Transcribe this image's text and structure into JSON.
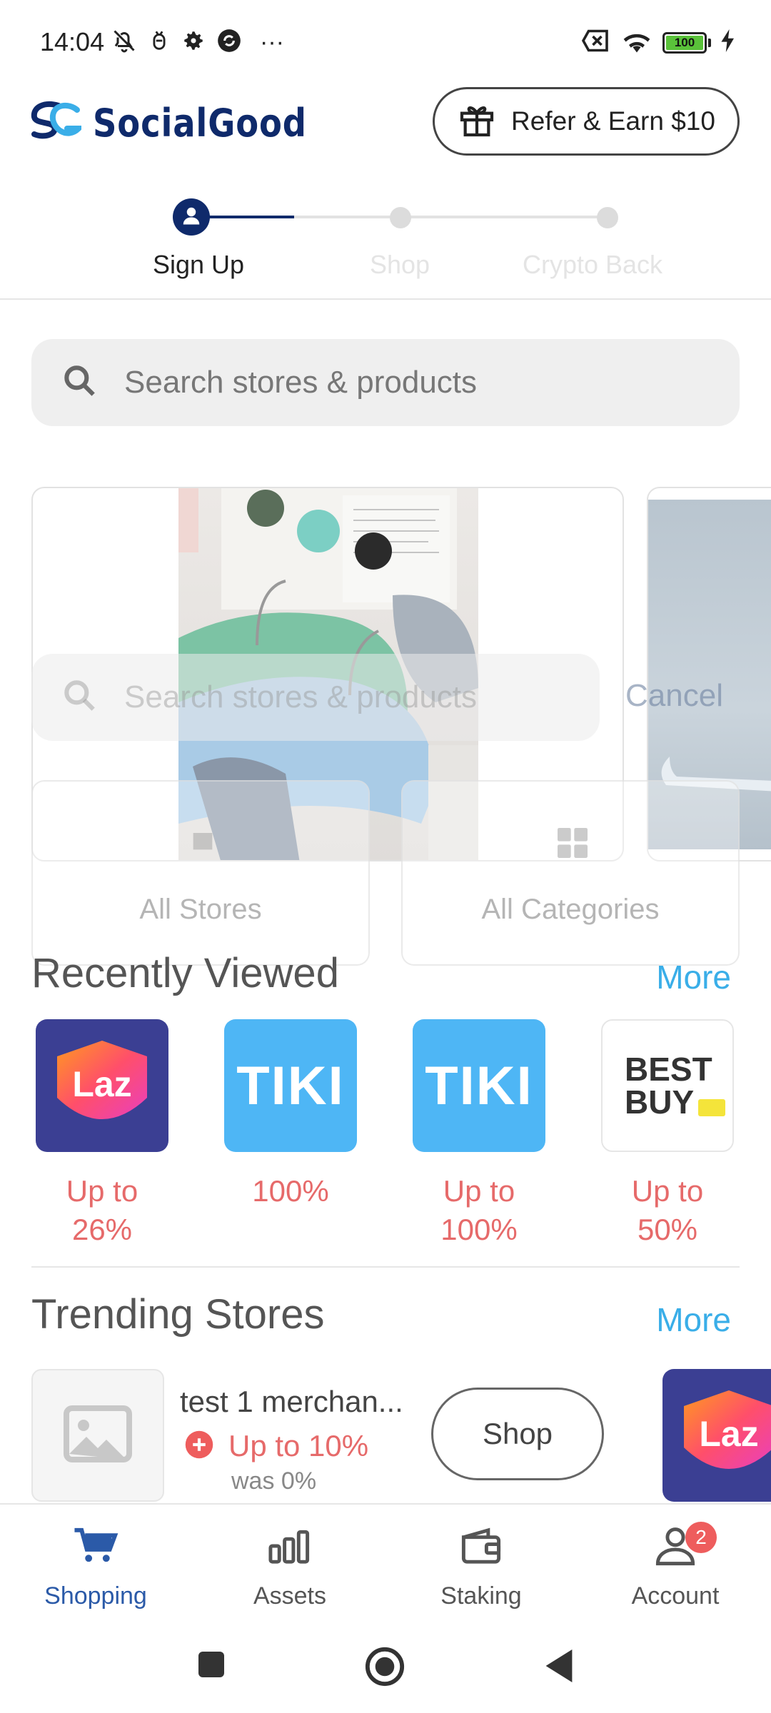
{
  "status_bar": {
    "time": "14:04",
    "left_icons": [
      "bell-off-icon",
      "bug-icon",
      "gear-icon",
      "sync-icon",
      "more-dots-icon"
    ],
    "more_glyph": "···",
    "battery_level": "100"
  },
  "header": {
    "brand": "SocialGood",
    "refer_label": "Refer & Earn $10"
  },
  "stepper": {
    "steps": [
      {
        "label": "Sign Up"
      },
      {
        "label": "Shop"
      },
      {
        "label": "Crypto Back"
      }
    ]
  },
  "search": {
    "placeholder": "Search stores & products"
  },
  "overlay": {
    "search_placeholder": "Search stores & products",
    "cancel_label": "Cancel",
    "cards": [
      {
        "label": "All Stores"
      },
      {
        "label": "All Categories"
      }
    ]
  },
  "recently_viewed": {
    "title": "Recently Viewed",
    "more_label": "More",
    "items": [
      {
        "logo_text": "Laz",
        "percent": "Up to 26%"
      },
      {
        "logo_text": "TIKI",
        "percent": "100%"
      },
      {
        "logo_text": "TIKI",
        "percent": "Up to 100%"
      },
      {
        "logo_text": "BEST BUY",
        "percent": "Up to 50%"
      }
    ]
  },
  "trending_stores": {
    "title": "Trending Stores",
    "more_label": "More",
    "items": [
      {
        "name": "test 1 merchan...",
        "offer": "Up to 10%",
        "was": "was 0%",
        "shop_label": "Shop"
      }
    ],
    "next_logo_text": "Laz"
  },
  "bottom_nav": {
    "items": [
      {
        "label": "Shopping"
      },
      {
        "label": "Assets"
      },
      {
        "label": "Staking"
      },
      {
        "label": "Account"
      }
    ],
    "account_badge": "2"
  },
  "colors": {
    "brand_navy": "#0f2a6b",
    "accent_blue": "#3aaee8",
    "offer_red": "#e66a6a",
    "active_nav": "#2b5aa8",
    "lazada_purple": "#3b3f93",
    "tiki_blue": "#1a9cf0"
  }
}
